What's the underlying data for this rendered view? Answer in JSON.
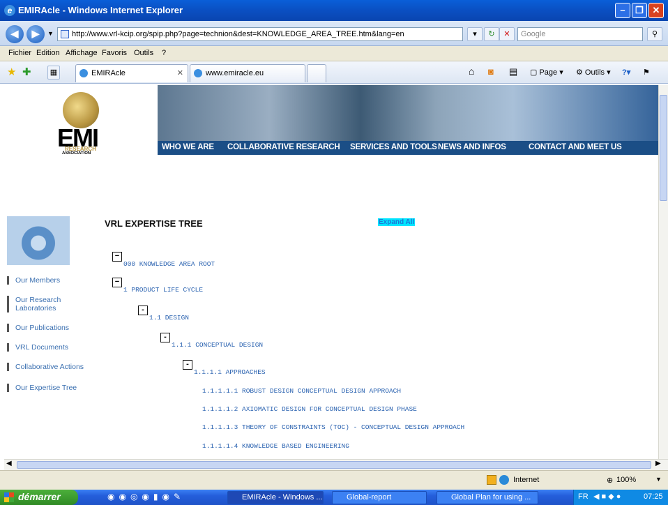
{
  "window": {
    "title": "EMIRAcle - Windows Internet Explorer",
    "min": "–",
    "max": "❐",
    "close": "✕"
  },
  "address": {
    "url": "http://www.vrl-kcip.org/spip.php?page=technion&dest=KNOWLEDGE_AREA_TREE.htm&lang=en",
    "search_placeholder": "Google"
  },
  "menu": [
    "Fichier",
    "Edition",
    "Affichage",
    "Favoris",
    "Outils",
    "?"
  ],
  "tabs": [
    {
      "label": "EMIRAcle"
    },
    {
      "label": "www.emiracle.eu"
    }
  ],
  "commands": {
    "page": "Page",
    "tools": "Outils"
  },
  "site": {
    "logo": {
      "main": "EMI",
      "sub1": "RESEARCH",
      "sub2": "ASSOCIATION"
    },
    "nav": [
      "WHO WE ARE",
      "COLLABORATIVE RESEARCH",
      "SERVICES AND TOOLS",
      "NEWS AND INFOS",
      "CONTACT AND MEET US"
    ],
    "sidebar": [
      "Our Members",
      "Our Research Laboratories",
      "Our Publications",
      "VRL Documents",
      "Collaborative Actions",
      "Our Expertise Tree"
    ],
    "tree_title": "VRL EXPERTISE TREE",
    "expand_all": "Expand All",
    "tree": [
      {
        "label": "000 KNOWLEDGE AREA ROOT",
        "toggle": "−"
      },
      {
        "label": "1 PRODUCT LIFE CYCLE",
        "toggle": "−"
      },
      {
        "label": "1.1 DESIGN",
        "toggle": "-"
      },
      {
        "label": "1.1.1 CONCEPTUAL DESIGN",
        "toggle": "-"
      },
      {
        "label": "1.1.1.1 APPROACHES",
        "toggle": "-"
      },
      {
        "label": "1.1.1.1.1 ROBUST DESIGN CONCEPTUAL DESIGN APPROACH"
      },
      {
        "label": "1.1.1.1.2 AXIOMATIC DESIGN FOR CONCEPTUAL DESIGN PHASE"
      },
      {
        "label": "1.1.1.1.3 THEORY OF CONSTRAINTS (TOC) - CONCEPTUAL DESIGN APPROACH"
      },
      {
        "label": "1.1.1.1.4 KNOWLEDGE BASED ENGINEERING"
      }
    ]
  },
  "status": {
    "zone": "Internet",
    "zoom": "100%"
  },
  "taskbar": {
    "start": "démarrer",
    "buttons": [
      "EMIRAcle - Windows ...",
      "Global-report",
      "Global Plan for using ..."
    ],
    "lang": "FR",
    "time": "07:25"
  },
  "colors": {
    "accent": "#1b4e86",
    "link": "#3a6fb0",
    "tree_text": "#2a62b0",
    "expand_bg": "#00e5ff"
  }
}
